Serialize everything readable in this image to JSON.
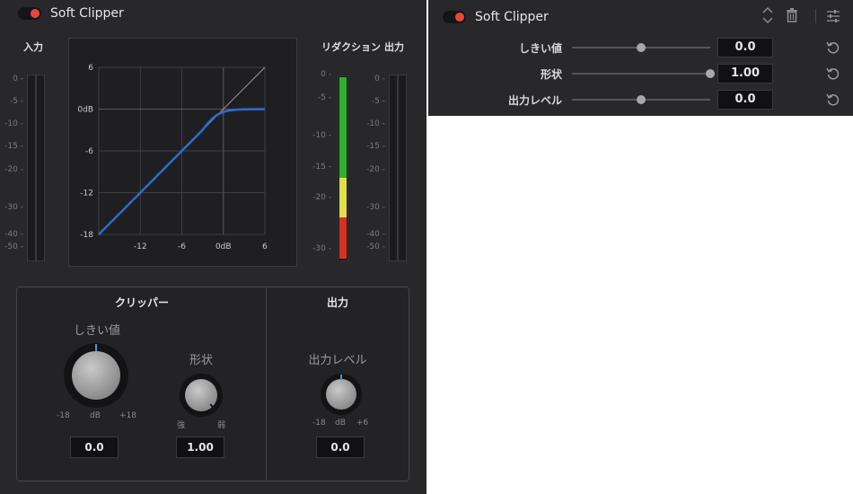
{
  "left": {
    "title": "Soft Clipper",
    "input_label": "入力",
    "reduction_label": "リダクション",
    "output_label": "出力",
    "input_ticks": [
      "0",
      "-5",
      "-10",
      "-15",
      "-20",
      "-30",
      "-40",
      "-50"
    ],
    "output_ticks": [
      "0",
      "-5",
      "-10",
      "-15",
      "-20",
      "-30",
      "-40",
      "-50"
    ],
    "reduction_ticks": [
      "0",
      "-5",
      "-10",
      "-15",
      "-20",
      "-30"
    ],
    "graph": {
      "y_ticks": [
        "6",
        "0dB",
        "-6",
        "-12",
        "-18"
      ],
      "x_ticks": [
        "-12",
        "-6",
        "0dB",
        "6"
      ],
      "curve_color": "#2f6bd2"
    },
    "reduction_colors": {
      "green": "#29b42a",
      "yellow": "#e0e04a",
      "red": "#d8321f"
    },
    "clipper": {
      "title": "クリッパー",
      "threshold": {
        "label": "しきい値",
        "min": "-18",
        "unit": "dB",
        "max": "+18",
        "value": "0.0"
      },
      "shape": {
        "label": "形状",
        "min": "強",
        "max": "弱",
        "value": "1.00"
      }
    },
    "output": {
      "title": "出力",
      "level": {
        "label": "出力レベル",
        "min": "-18",
        "unit": "dB",
        "max": "+6",
        "value": "0.0"
      }
    }
  },
  "right": {
    "title": "Soft Clipper",
    "icons": [
      "chevron-updown-icon",
      "trash-icon",
      "sliders-icon"
    ],
    "params": [
      {
        "label": "しきい値",
        "value": "0.0",
        "position": 0.5
      },
      {
        "label": "形状",
        "value": "1.00",
        "position": 1.0
      },
      {
        "label": "出力レベル",
        "value": "0.0",
        "position": 0.5
      }
    ]
  }
}
